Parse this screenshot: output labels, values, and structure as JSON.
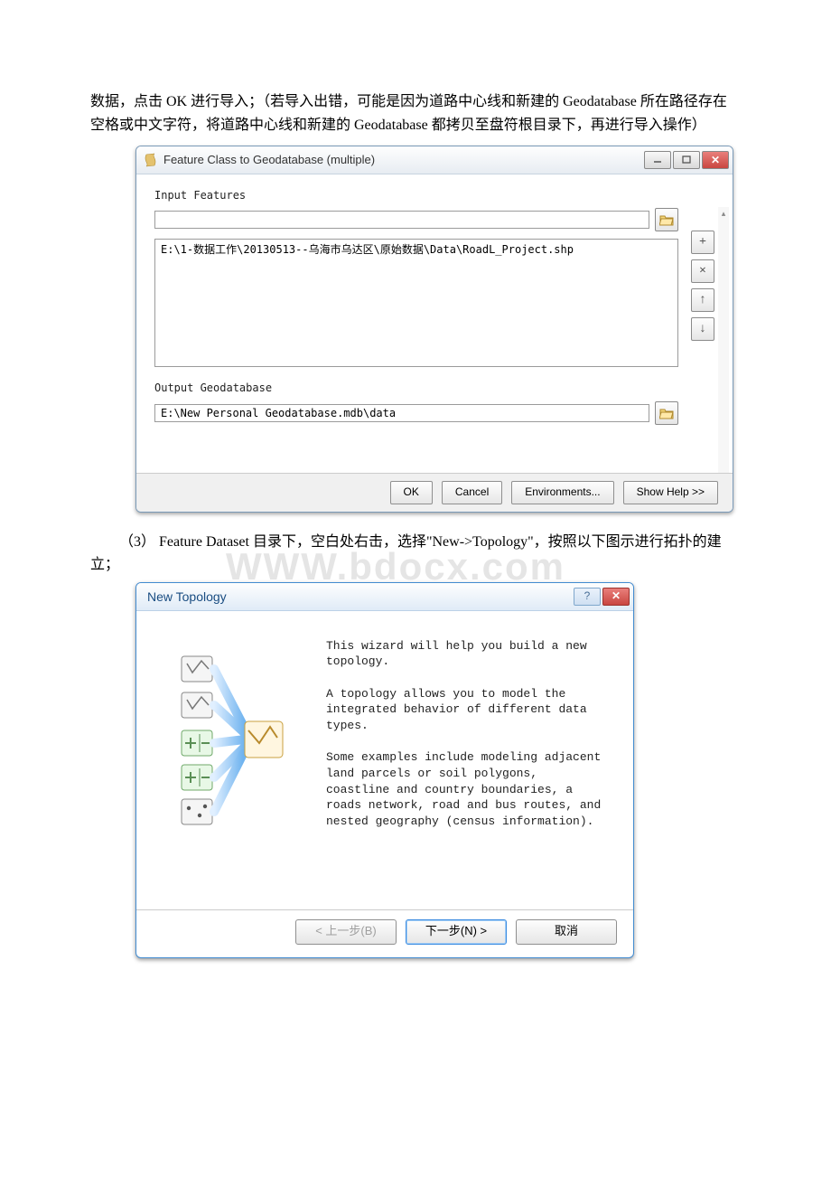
{
  "doc": {
    "para1": "数据，点击 OK 进行导入；（若导入出错，可能是因为道路中心线和新建的 Geodatabase 所在路径存在空格或中文字符，将道路中心线和新建的 Geodatabase 都拷贝至盘符根目录下，再进行导入操作）",
    "para2": "（3） Feature Dataset 目录下，空白处右击，选择\"New->Topology\"，按照以下图示进行拓扑的建立；",
    "watermark": "WWW.bdocx.com"
  },
  "dialog1": {
    "title": "Feature Class to Geodatabase (multiple)",
    "input_features_label": "Input Features",
    "input_features_value": "",
    "feature_list_item": "E:\\1-数据工作\\20130513--乌海市乌达区\\原始数据\\Data\\RoadL_Project.shp",
    "output_label": "Output Geodatabase",
    "output_value": "E:\\New Personal Geodatabase.mdb\\data",
    "buttons": {
      "ok": "OK",
      "cancel": "Cancel",
      "env": "Environments...",
      "help": "Show Help >>"
    },
    "side": {
      "add": "+",
      "remove": "×",
      "up": "↑",
      "down": "↓"
    }
  },
  "dialog2": {
    "title": "New Topology",
    "p1": "This wizard will help you build a new topology.",
    "p2": "A topology allows you to model the integrated behavior of different data types.",
    "p3": "Some examples include modeling adjacent land parcels or soil polygons, coastline and country boundaries, a roads network, road and bus routes, and nested geography (census information).",
    "buttons": {
      "back": "< 上一步(B)",
      "next": "下一步(N) >",
      "cancel": "取消"
    }
  }
}
